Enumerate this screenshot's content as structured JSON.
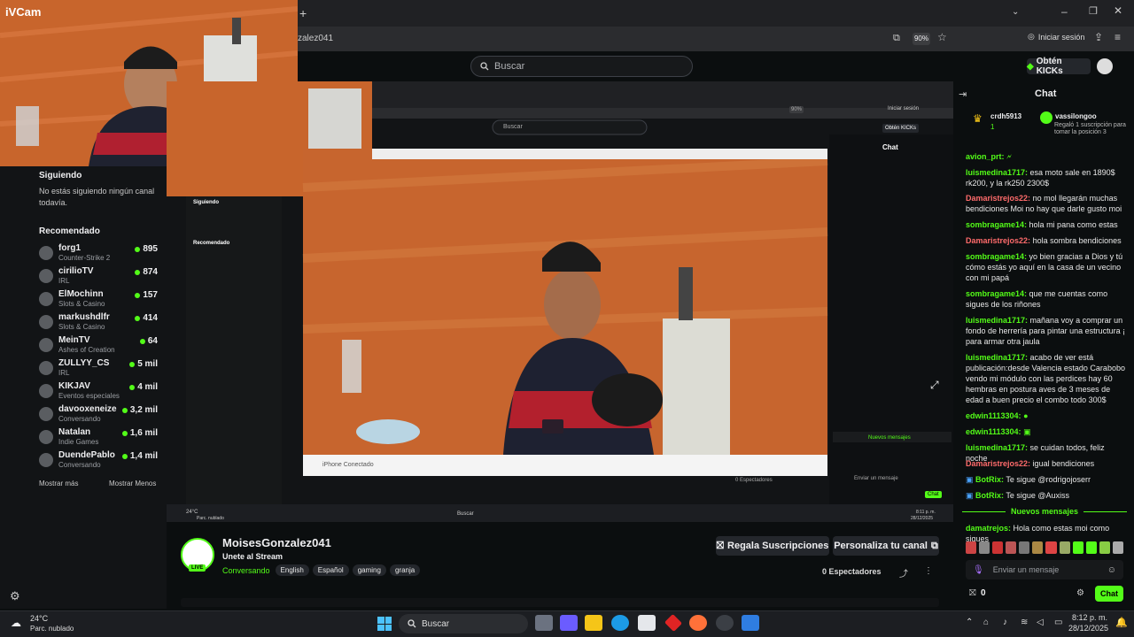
{
  "overlay": {
    "brand": "iVCam"
  },
  "browser": {
    "url_fragment": "zalez041",
    "zoom": "90%",
    "login_label": "Iniciar sesión"
  },
  "topnav": {
    "search_placeholder": "Buscar",
    "kicks_label": "Obtén KICKs"
  },
  "sidebar": {
    "following_heading": "Siguiendo",
    "following_empty": "No estás siguiendo ningún canal todavía.",
    "recommended_heading": "Recomendado",
    "channels": [
      {
        "name": "forg1",
        "category": "Counter-Strike 2",
        "viewers": "895"
      },
      {
        "name": "cirilioTV",
        "category": "IRL",
        "viewers": "874"
      },
      {
        "name": "ElMochinn",
        "category": "Slots & Casino",
        "viewers": "157"
      },
      {
        "name": "markushdlfr",
        "category": "Slots & Casino",
        "viewers": "414"
      },
      {
        "name": "MeinTV",
        "category": "Ashes of Creation",
        "viewers": "64"
      },
      {
        "name": "ZULLYY_CS",
        "category": "IRL",
        "viewers": "5 mil"
      },
      {
        "name": "KIKJAV",
        "category": "Eventos especiales",
        "viewers": "4 mil"
      },
      {
        "name": "davooxeneize",
        "category": "Conversando",
        "viewers": "3,2 mil"
      },
      {
        "name": "Natalan",
        "category": "Indie Games",
        "viewers": "1,6 mil"
      },
      {
        "name": "DuendePablo",
        "category": "Conversando",
        "viewers": "1,4 mil"
      }
    ],
    "show_more": "Mostrar más",
    "show_less": "Mostrar Menos"
  },
  "nested": {
    "search_placeholder": "Buscar",
    "login_label": "Iniciar sesión",
    "kicks_label": "Obtén KICKs",
    "chat_title": "Chat",
    "camera_label": "iPhone Conectado",
    "following_heading": "Siguiendo",
    "recommended_heading": "Recomendado",
    "zoom": "90%",
    "new_messages": "Nuevos mensajes",
    "chat_placeholder": "Enviar un mensaje",
    "viewers": "0 Espectadores",
    "chat_button": "Chat",
    "taskbar_temp": "24°C",
    "taskbar_weather": "Parc. nublado",
    "taskbar_time": "8:11 p. m.",
    "taskbar_date": "28/12/2025",
    "taskbar_search": "Buscar"
  },
  "chat": {
    "title": "Chat",
    "pinned": {
      "user1": "crdh5913",
      "user2": "vassilongoo",
      "count": "1",
      "text": "Regaló 1 suscripción para tomar la posición 3"
    },
    "messages": [
      {
        "user": "avion_prt:",
        "text": "",
        "color": "#53fc18"
      },
      {
        "user": "luismedina1717:",
        "text": "esa moto sale en 1890$ rk200, y la rk250 2300$",
        "color": "#53fc18"
      },
      {
        "user": "Damaristrejos22:",
        "text": "no mol llegarán muchas bendiciones Moi no hay que darle gusto moi",
        "color": "#ff6b6b"
      },
      {
        "user": "sombragame14:",
        "text": "hola mi pana como estas",
        "color": "#53fc18"
      },
      {
        "user": "Damaristrejos22:",
        "text": "hola sombra bendiciones",
        "color": "#ff6b6b"
      },
      {
        "user": "sombragame14:",
        "text": "yo bien gracias a Dios y tú cómo estás yo aquí en la casa de un vecino con mi papá",
        "color": "#53fc18"
      },
      {
        "user": "sombragame14:",
        "text": "que me cuentas como sigues de los riñones",
        "color": "#53fc18"
      },
      {
        "user": "luismedina1717:",
        "text": "mañana voy a comprar un fondo de herrería para pintar una estructura ¡ para armar otra jaula",
        "color": "#53fc18"
      },
      {
        "user": "luismedina1717:",
        "text": "acabo de ver está publicación:desde Valencia estado Carabobo vendo mi módulo con las perdices hay 60 hembras en postura aves de 3 meses de edad a buen precio el combo todo 300$",
        "color": "#53fc18"
      },
      {
        "user": "edwin1113304:",
        "text": "",
        "color": "#53fc18"
      },
      {
        "user": "edwin1113304:",
        "text": "",
        "color": "#53fc18"
      },
      {
        "user": "luismedina1717:",
        "text": "se cuidan todos, feliz noche",
        "color": "#53fc18"
      },
      {
        "user": "Damaristrejos22:",
        "text": "igual bendiciones",
        "color": "#ff6b6b"
      },
      {
        "user": "BotRix:",
        "text": "Te sigue @rodrigojoserr",
        "color": "#53fc18"
      },
      {
        "user": "BotRix:",
        "text": "Te sigue @Auxiss",
        "color": "#53fc18"
      }
    ],
    "new_messages": "Nuevos mensajes",
    "last": {
      "user": "damatrejos:",
      "text": "Hola como estas moi como sigues"
    },
    "input_placeholder": "Enviar un mensaje",
    "count": "0",
    "send_label": "Chat"
  },
  "stream": {
    "channel": "MoisesGonzalez041",
    "title": "Unete al Stream",
    "live_badge": "LIVE",
    "category": "Conversando",
    "tags": [
      "English",
      "Español",
      "gaming",
      "granja"
    ],
    "gift_button": "Regala Suscripciones",
    "customize_button": "Personaliza tu canal",
    "viewers": "0 Espectadores"
  },
  "taskbar": {
    "temp": "24°C",
    "weather": "Parc. nublado",
    "search": "Buscar",
    "time": "8:12 p. m.",
    "date": "28/12/2025"
  },
  "colors": {
    "kick_green": "#53fc18",
    "bg": "#0b0e0f",
    "panel": "#24272c"
  }
}
